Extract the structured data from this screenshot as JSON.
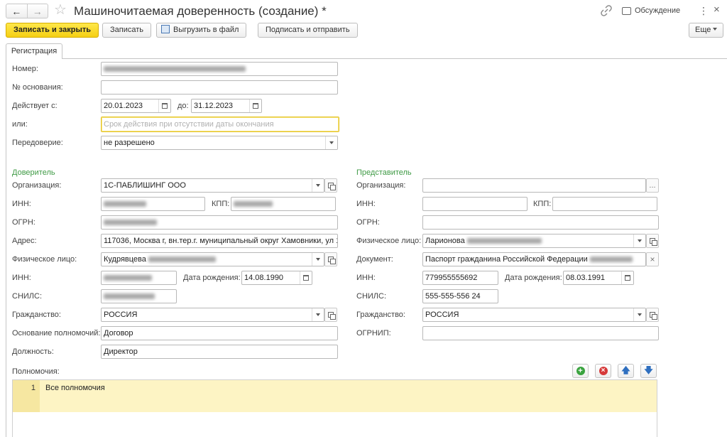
{
  "window": {
    "title": "Машиночитаемая доверенность (создание) *",
    "discussion_label": "Обсуждение"
  },
  "toolbar": {
    "save_close": "Записать и закрыть",
    "save": "Записать",
    "export": "Выгрузить в файл",
    "sign_send": "Подписать и отправить",
    "more": "Еще"
  },
  "tabs": {
    "registration": "Регистрация"
  },
  "form": {
    "number_label": "Номер:",
    "basis_number_label": "№ основания:",
    "valid_from_label": "Действует с:",
    "valid_from": "20.01.2023",
    "valid_to_label": "до:",
    "valid_to": "31.12.2023",
    "or_label": "или:",
    "or_placeholder": "Срок действия при отсутствии даты окончания",
    "redelegation_label": "Передоверие:",
    "redelegation": "не разрешено"
  },
  "principal": {
    "heading": "Доверитель",
    "org_label": "Организация:",
    "org": "1С-ПАБЛИШИНГ ООО",
    "inn_label": "ИНН:",
    "kpp_label": "КПП:",
    "ogrn_label": "ОГРН:",
    "address_label": "Адрес:",
    "address": "117036, Москва г, вн.тер.г. муниципальный округ Хамовники, ул 1",
    "person_label": "Физическое лицо:",
    "person": "Кудрявцева",
    "person_inn_label": "ИНН:",
    "birth_label": "Дата рождения:",
    "birth": "14.08.1990",
    "snils_label": "СНИЛС:",
    "citizenship_label": "Гражданство:",
    "citizenship": "РОССИЯ",
    "authority_basis_label": "Основание полномочий:",
    "authority_basis": "Договор",
    "position_label": "Должность:",
    "position": "Директор"
  },
  "representative": {
    "heading": "Представитель",
    "org_label": "Организация:",
    "inn_label": "ИНН:",
    "kpp_label": "КПП:",
    "ogrn_label": "ОГРН:",
    "person_label": "Физическое лицо:",
    "person": "Ларионова",
    "document_label": "Документ:",
    "document": "Паспорт гражданина Российской Федерации",
    "person_inn_label": "ИНН:",
    "person_inn": "779955555692",
    "birth_label": "Дата рождения:",
    "birth": "08.03.1991",
    "snils_label": "СНИЛС:",
    "snils": "555-555-556 24",
    "citizenship_label": "Гражданство:",
    "citizenship": "РОССИЯ",
    "ogrnip_label": "ОГРНИП:"
  },
  "powers": {
    "label": "Полномочия:",
    "rows": [
      {
        "n": "1",
        "text": "Все полномочия"
      }
    ]
  },
  "icons": [
    "back-arrow-icon",
    "forward-arrow-icon",
    "star-icon",
    "link-icon",
    "discussion-icon",
    "more-vert-icon",
    "close-icon",
    "calendar-icon",
    "dropdown-icon",
    "open-form-icon",
    "clear-icon",
    "add-icon",
    "delete-icon",
    "move-up-icon",
    "move-down-icon"
  ],
  "colors": {
    "primary_button": "#f5cf14",
    "section_heading": "#3f9a45",
    "focus_border": "#e4c42a",
    "table_row": "#fdf4c4"
  }
}
